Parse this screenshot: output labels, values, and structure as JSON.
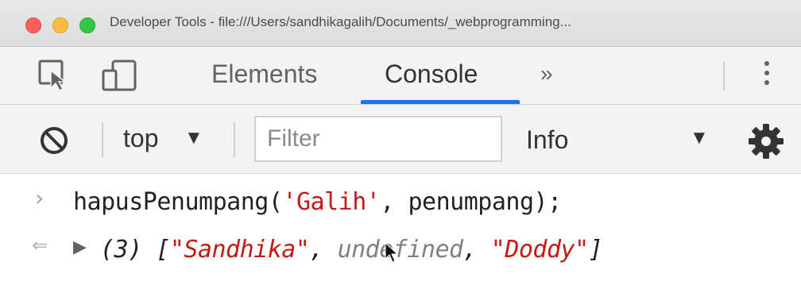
{
  "window": {
    "title": "Developer Tools - file:///Users/sandhikagalih/Documents/_webprogramming..."
  },
  "tabs": {
    "elements": "Elements",
    "console": "Console",
    "more": "»",
    "active": "Console"
  },
  "console_toolbar": {
    "context": "top",
    "context_arrow": "▼",
    "filter_placeholder": "Filter",
    "level": "Info",
    "level_arrow": "▼"
  },
  "console": {
    "input_prompt": "›",
    "command": {
      "fn": "hapusPenumpang(",
      "arg1": "'Galih'",
      "rest": ", penumpang);"
    },
    "result_arrow": "⇐",
    "expand_arrow": "▶",
    "result": {
      "count": "(3) [",
      "item1": "\"Sandhika\"",
      "sep1": ", ",
      "item2": "undefined",
      "sep2": ", ",
      "item3": "\"Doddy\"",
      "close": "]"
    }
  },
  "colors": {
    "accent": "#1a73e8",
    "string": "#c41a16",
    "close": "#fc605c",
    "minimize": "#fdbc40",
    "maximize": "#34c84a"
  },
  "icons": [
    "inspect-element-icon",
    "device-toolbar-icon",
    "clear-console-icon",
    "settings-gear-icon",
    "more-options-icon"
  ]
}
